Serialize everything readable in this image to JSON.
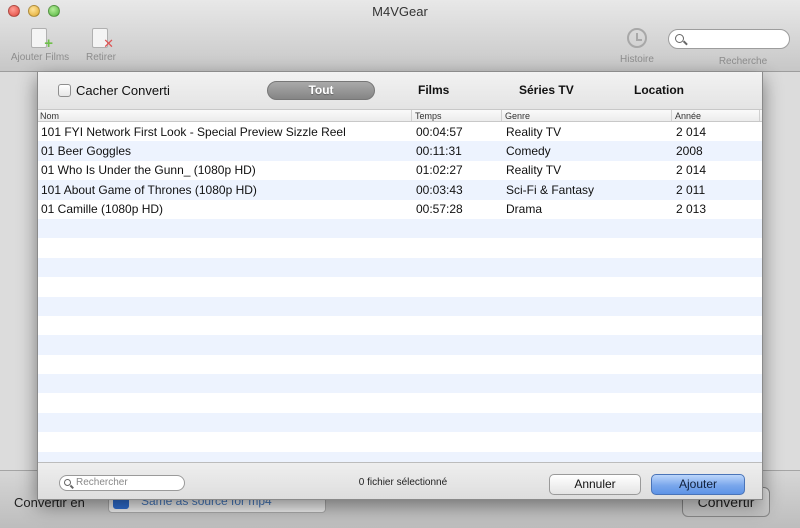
{
  "window": {
    "title": "M4VGear"
  },
  "toolbar": {
    "add_label": "Ajouter Films",
    "remove_label": "Retirer",
    "history_label": "Histoire",
    "search_label": "Recherche",
    "search_placeholder": ""
  },
  "bottom_bar": {
    "convert_label": "Convertir en",
    "format_value": "Same as source for mp4",
    "convert_button": "Convertir"
  },
  "sheet": {
    "hide_converted_label": "Cacher Converti",
    "hide_converted_checked": false,
    "tabs": [
      {
        "label": "Tout",
        "selected": true
      },
      {
        "label": "Films",
        "selected": false
      },
      {
        "label": "Séries TV",
        "selected": false
      },
      {
        "label": "Location",
        "selected": false
      }
    ],
    "columns": [
      "Nom",
      "Temps",
      "Genre",
      "Année"
    ],
    "rows": [
      {
        "nom": "101 FYI Network First Look - Special Preview Sizzle Reel",
        "temps": "00:04:57",
        "genre": "Reality TV",
        "annee": "2 014"
      },
      {
        "nom": "01 Beer Goggles",
        "temps": "00:11:31",
        "genre": "Comedy",
        "annee": "2008"
      },
      {
        "nom": "01 Who Is Under the Gunn_ (1080p HD)",
        "temps": "01:02:27",
        "genre": "Reality TV",
        "annee": "2 014"
      },
      {
        "nom": "101 About Game of Thrones (1080p HD)",
        "temps": "00:03:43",
        "genre": "Sci-Fi & Fantasy",
        "annee": "2 011"
      },
      {
        "nom": "01 Camille (1080p HD)",
        "temps": "00:57:28",
        "genre": "Drama",
        "annee": "2 013"
      },
      {
        "nom": "",
        "temps": "",
        "genre": "",
        "annee": ""
      },
      {
        "nom": "",
        "temps": "",
        "genre": "",
        "annee": ""
      },
      {
        "nom": "",
        "temps": "",
        "genre": "",
        "annee": ""
      },
      {
        "nom": "",
        "temps": "",
        "genre": "",
        "annee": ""
      },
      {
        "nom": "",
        "temps": "",
        "genre": "",
        "annee": ""
      },
      {
        "nom": "",
        "temps": "",
        "genre": "",
        "annee": ""
      },
      {
        "nom": "",
        "temps": "",
        "genre": "",
        "annee": ""
      },
      {
        "nom": "",
        "temps": "",
        "genre": "",
        "annee": ""
      },
      {
        "nom": "",
        "temps": "",
        "genre": "",
        "annee": ""
      },
      {
        "nom": "",
        "temps": "",
        "genre": "",
        "annee": ""
      },
      {
        "nom": "",
        "temps": "",
        "genre": "",
        "annee": ""
      },
      {
        "nom": "",
        "temps": "",
        "genre": "",
        "annee": ""
      },
      {
        "nom": "",
        "temps": "",
        "genre": "",
        "annee": ""
      }
    ],
    "search_placeholder": "Rechercher",
    "selected_count_text": "0 fichier sélectionné",
    "cancel_button": "Annuler",
    "add_button": "Ajouter"
  },
  "colors": {
    "row_alt": "#edf3fe",
    "selected_tab": "#8f8f8f",
    "default_button": "#7aa7ec"
  }
}
